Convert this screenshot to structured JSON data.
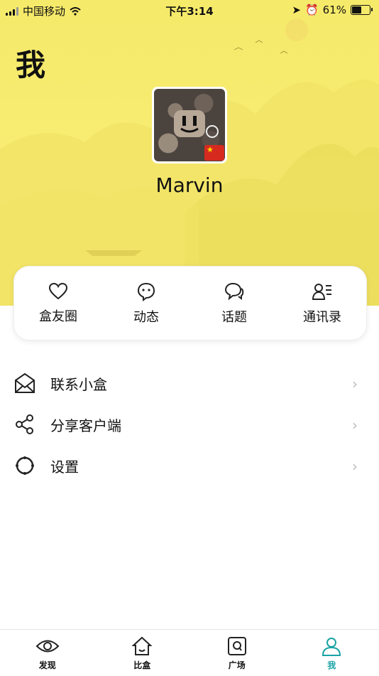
{
  "status_bar": {
    "carrier": "中国移动",
    "time": "下午3:14",
    "battery": "61%",
    "battery_level": 0.61
  },
  "page": {
    "title": "我"
  },
  "profile": {
    "username": "Marvin"
  },
  "quick_actions": [
    {
      "label": "盒友圈",
      "icon": "heart-icon"
    },
    {
      "label": "动态",
      "icon": "chat-bubble-face-icon"
    },
    {
      "label": "话题",
      "icon": "chat-bubbles-icon"
    },
    {
      "label": "通讯录",
      "icon": "contacts-icon"
    }
  ],
  "menu": [
    {
      "label": "联系小盒",
      "icon": "mail-icon"
    },
    {
      "label": "分享客户端",
      "icon": "share-icon"
    },
    {
      "label": "设置",
      "icon": "settings-icon"
    }
  ],
  "tabs": [
    {
      "label": "发现",
      "icon": "eye-icon"
    },
    {
      "label": "比盒",
      "icon": "home-icon"
    },
    {
      "label": "广场",
      "icon": "square-icon"
    },
    {
      "label": "我",
      "icon": "person-icon",
      "active": true
    }
  ],
  "colors": {
    "header": "#f6ea6a",
    "accent": "#1aa3a6"
  }
}
